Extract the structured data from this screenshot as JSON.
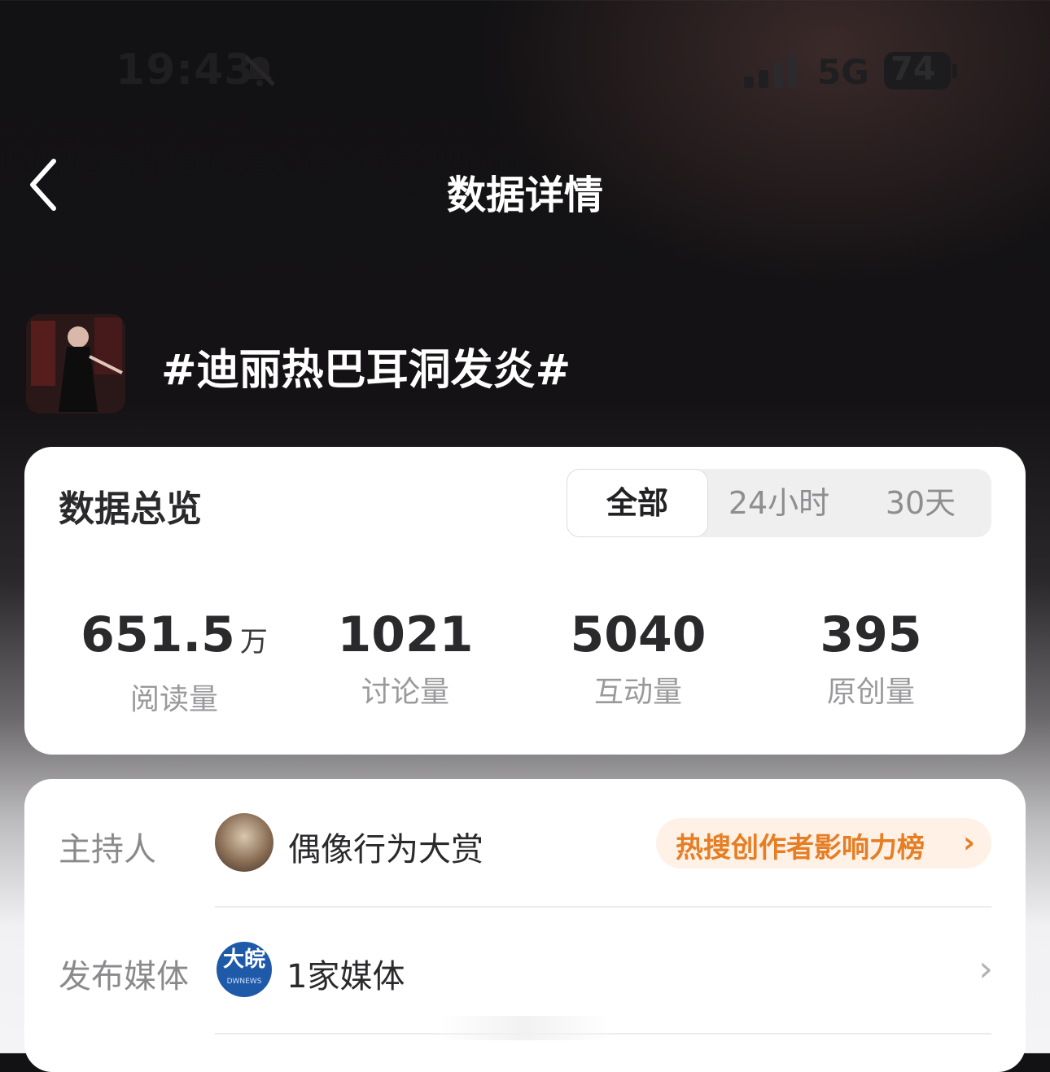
{
  "status_bar": {
    "time": "19:43",
    "network": "5G",
    "battery": "74",
    "icons": [
      "bell-muted-icon",
      "signal-icon",
      "battery-icon"
    ]
  },
  "nav": {
    "title": "数据详情",
    "back_icon": "chevron-left-icon"
  },
  "topic": {
    "title": "#迪丽热巴耳洞发炎#"
  },
  "overview": {
    "title": "数据总览",
    "tabs": [
      {
        "label": "全部",
        "active": true
      },
      {
        "label": "24小时",
        "active": false
      },
      {
        "label": "30天",
        "active": false
      }
    ],
    "stats": [
      {
        "value": "651.5",
        "unit": "万",
        "label": "阅读量"
      },
      {
        "value": "1021",
        "unit": "",
        "label": "讨论量"
      },
      {
        "value": "5040",
        "unit": "",
        "label": "互动量"
      },
      {
        "value": "395",
        "unit": "",
        "label": "原创量"
      }
    ]
  },
  "info": {
    "host_label": "主持人",
    "host_name": "偶像行为大赏",
    "rank_link": "热搜创作者影响力榜",
    "media_label": "发布媒体",
    "media_logo_text": "大皖",
    "media_logo_sub": "DWNEWS",
    "media_count": "1家媒体"
  },
  "colors": {
    "accent_orange": "#e57e24",
    "pill_bg": "#fff1e6",
    "media_blue": "#1f5aa8"
  }
}
